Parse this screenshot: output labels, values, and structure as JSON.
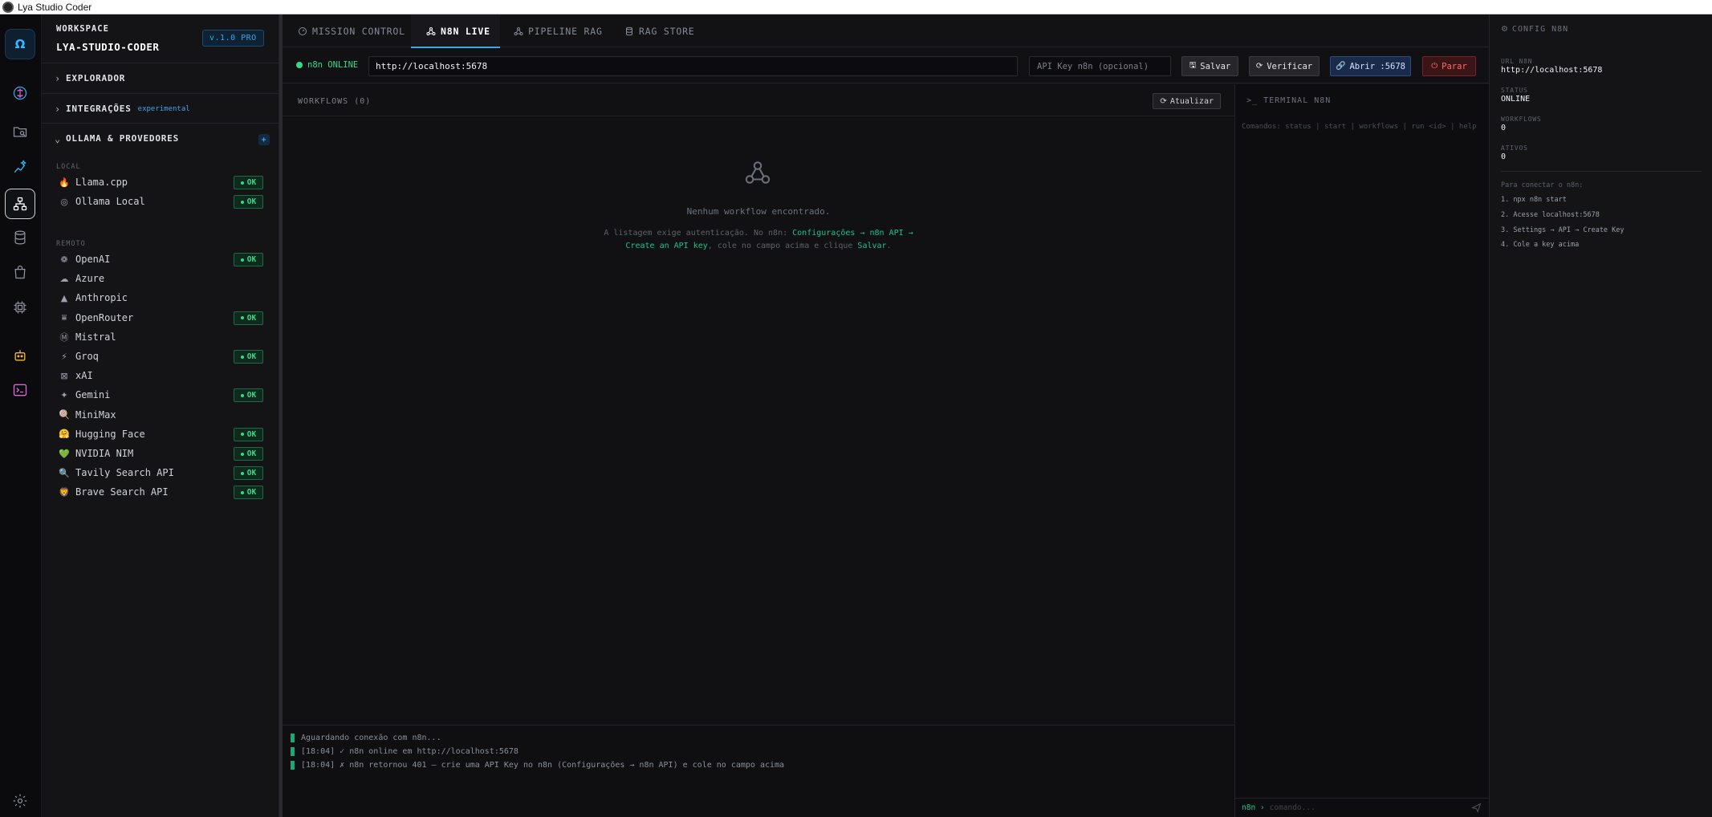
{
  "window": {
    "title": "Lya Studio Coder"
  },
  "activity_bar": {
    "logo": "Ω"
  },
  "sidebar": {
    "workspace_label": "WORKSPACE",
    "workspace_name": "LYA-STUDIO-CODER",
    "version": "v.1.0 PRO",
    "sections": {
      "explorer": "EXPLORADOR",
      "integrations": "INTEGRAÇÕES",
      "integrations_tag": "experimental",
      "providers": "OLLAMA & PROVEDORES",
      "add": "+"
    },
    "group_local": "LOCAL",
    "group_remote": "REMOTO",
    "ok_label": "OK",
    "local_providers": [
      {
        "name": "Llama.cpp",
        "icon": "🔥",
        "status": "OK"
      },
      {
        "name": "Ollama Local",
        "icon": "◎",
        "status": "OK"
      }
    ],
    "remote_providers": [
      {
        "name": "OpenAI",
        "icon": "❁",
        "status": "OK"
      },
      {
        "name": "Azure",
        "icon": "☁",
        "status": ""
      },
      {
        "name": "Anthropic",
        "icon": "▲",
        "status": ""
      },
      {
        "name": "OpenRouter",
        "icon": "⩸",
        "status": "OK"
      },
      {
        "name": "Mistral",
        "icon": "Ⓜ",
        "status": ""
      },
      {
        "name": "Groq",
        "icon": "⚡",
        "status": "OK"
      },
      {
        "name": "xAI",
        "icon": "⊠",
        "status": ""
      },
      {
        "name": "Gemini",
        "icon": "✦",
        "status": "OK"
      },
      {
        "name": "MiniMax",
        "icon": "🍭",
        "status": ""
      },
      {
        "name": "Hugging Face",
        "icon": "🤗",
        "status": "OK"
      },
      {
        "name": "NVIDIA NIM",
        "icon": "💚",
        "status": "OK"
      },
      {
        "name": "Tavily Search API",
        "icon": "🔍",
        "status": "OK"
      },
      {
        "name": "Brave Search API",
        "icon": "🦁",
        "status": "OK"
      }
    ]
  },
  "tabs": [
    {
      "label": "MISSION CONTROL",
      "icon": "gauge-icon"
    },
    {
      "label": "N8N LIVE",
      "icon": "webhook-icon"
    },
    {
      "label": "PIPELINE RAG",
      "icon": "webhook-icon"
    },
    {
      "label": "RAG STORE",
      "icon": "database-icon"
    }
  ],
  "active_tab": "N8N LIVE",
  "toolbar": {
    "status": "n8n ONLINE",
    "url_value": "http://localhost:5678",
    "api_key_placeholder": "API Key n8n (opcional)",
    "save_label": "Salvar",
    "verify_label": "Verificar",
    "open_label": "Abrir :5678",
    "stop_label": "Parar"
  },
  "workflows": {
    "title": "WORKFLOWS (0)",
    "refresh_label": "Atualizar",
    "empty_title": "Nenhum workflow encontrado.",
    "hint_prefix": "A listagem exige autenticação. No n8n: ",
    "hint_link1": "Configurações → n8n API →",
    "hint_link2": "Create an API key",
    "hint_mid": ", cole no campo acima e clique ",
    "hint_link3": "Salvar",
    "hint_end": "."
  },
  "log": {
    "lines": [
      "Aguardando conexão com n8n...",
      "[18:04] ✓ n8n online em http://localhost:5678",
      "[18:04] ✗ n8n retornou 401 — crie uma API Key no n8n (Configurações → n8n API) e cole no campo acima"
    ]
  },
  "terminal": {
    "title": "TERMINAL N8N",
    "hint": "Comandos: status | start | workflows | run <id> | help",
    "prompt": "n8n ›",
    "input_placeholder": "comando..."
  },
  "config": {
    "title": "CONFIG N8N",
    "url_label": "URL N8N",
    "url_value": "http://localhost:5678",
    "status_label": "STATUS",
    "status_value": "ONLINE",
    "workflows_label": "WORKFLOWS",
    "workflows_value": "0",
    "active_label": "ATIVOS",
    "active_value": "0",
    "connect_label": "Para conectar o n8n:",
    "steps": [
      "1. npx n8n start",
      "2. Acesse localhost:5678",
      "3. Settings → API → Create Key",
      "4. Cole a key acima"
    ]
  },
  "colors": {
    "accent": "#3aa6ec",
    "online": "#36d88a",
    "danger": "#ff6b6b",
    "background": "#111114"
  }
}
